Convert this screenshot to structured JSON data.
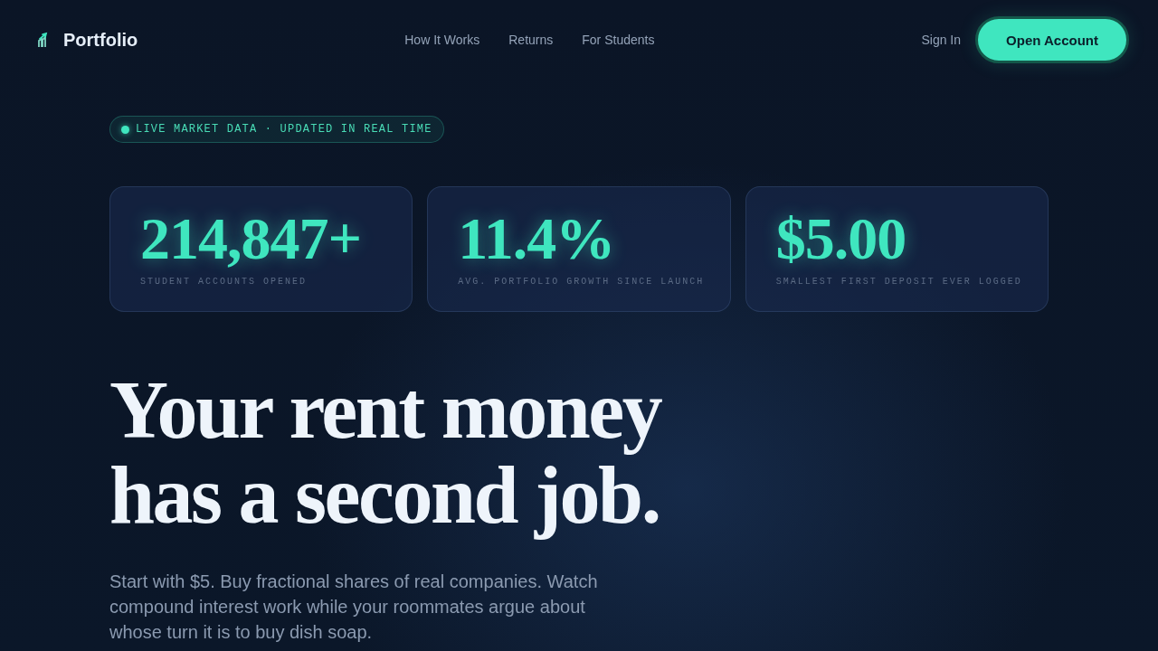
{
  "nav": {
    "brand": "Portfolio",
    "links": [
      "How It Works",
      "Returns",
      "For Students"
    ],
    "sign_in": "Sign In",
    "cta": "Open Account"
  },
  "hero": {
    "badge": "LIVE MARKET DATA · UPDATED IN REAL TIME",
    "stats": [
      {
        "value": "214,847+",
        "label": "STUDENT ACCOUNTS OPENED"
      },
      {
        "value": "11.4%",
        "label": "AVG. PORTFOLIO GROWTH SINCE LAUNCH"
      },
      {
        "value": "$5.00",
        "label": "SMALLEST FIRST DEPOSIT EVER LOGGED"
      }
    ],
    "headline": [
      "Your rent money",
      "has a second job."
    ],
    "description": "Start with $5. Buy fractional shares of real companies. Watch compound interest work while your roommates argue about whose turn it is to buy dish soap."
  }
}
